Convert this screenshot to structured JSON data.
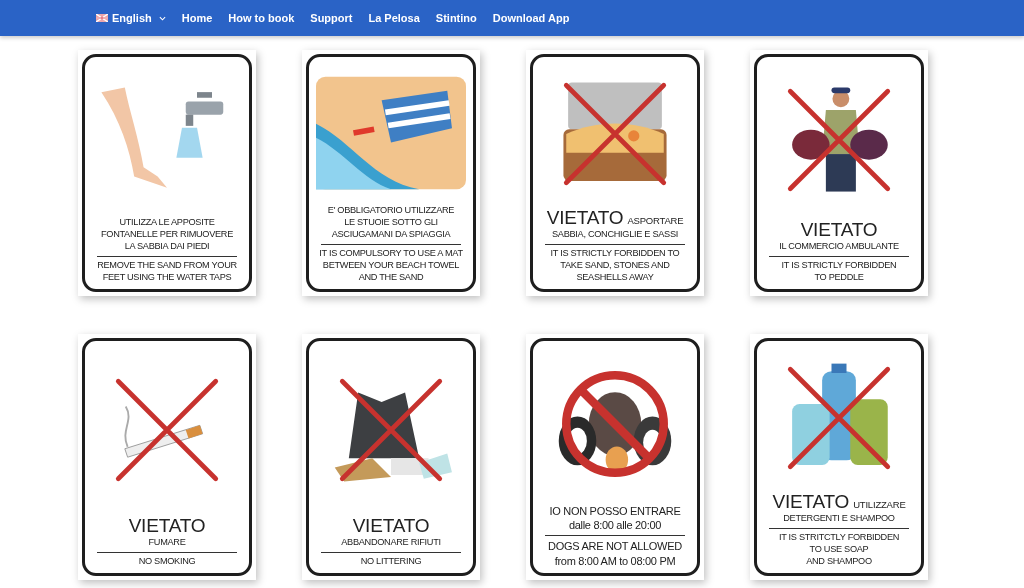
{
  "nav": {
    "language": "English",
    "items": [
      "Home",
      "How to book",
      "Support",
      "La Pelosa",
      "Stintino",
      "Download App"
    ]
  },
  "signs": [
    {
      "kind": "tap",
      "crossed": false,
      "circled": false,
      "italian": "UTILIZZA LE APPOSITE\nFONTANELLE PER RIMUOVERE\nLA SABBIA DAI PIEDI",
      "english": "REMOVE THE SAND FROM YOUR\nFEET USING THE WATER TAPS"
    },
    {
      "kind": "towel",
      "crossed": false,
      "circled": false,
      "italian": "E' OBBLIGATORIO UTILIZZARE\nLE STUOIE SOTTO GLI\nASCIUGAMANI DA SPIAGGIA",
      "english": "IT IS COMPULSORY TO USE A MAT\nBETWEEN YOUR BEACH TOWEL\nAND THE SAND"
    },
    {
      "kind": "suitcase",
      "crossed": true,
      "circled": false,
      "headline": "VIETATO",
      "headline_rest": "ASPORTARE",
      "italian": "SABBIA, CONCHIGLIE E SASSI",
      "english": "IT IS STRICTLY FORBIDDEN TO\nTAKE SAND, STONES AND\nSEASHELLS AWAY"
    },
    {
      "kind": "peddler",
      "crossed": true,
      "circled": false,
      "headline": "VIETATO",
      "italian": "IL COMMERCIO AMBULANTE",
      "english": "IT IS STRICTLY FORBIDDEN\nTO PEDDLE"
    },
    {
      "kind": "cigarette",
      "crossed": true,
      "circled": false,
      "headline": "VIETATO",
      "italian": "FUMARE",
      "english": "NO SMOKING"
    },
    {
      "kind": "trash",
      "crossed": true,
      "circled": false,
      "headline": "VIETATO",
      "italian": "ABBANDONARE RIFIUTI",
      "english": "NO LITTERING"
    },
    {
      "kind": "dogs",
      "crossed": false,
      "circled": true,
      "italian": "IO NON POSSO ENTRARE\ndalle 8:00 alle 20:00",
      "english": "DOGS ARE NOT ALLOWED\nfrom 8:00 AM to 08:00 PM"
    },
    {
      "kind": "bottles",
      "crossed": true,
      "circled": false,
      "headline": "VIETATO",
      "headline_rest": "UTILIZZARE",
      "italian": "DETERGENTI E SHAMPOO",
      "english": "IT IS STRITCTLY FORBIDDEN\nTO USE SOAP\nAND SHAMPOO"
    }
  ]
}
